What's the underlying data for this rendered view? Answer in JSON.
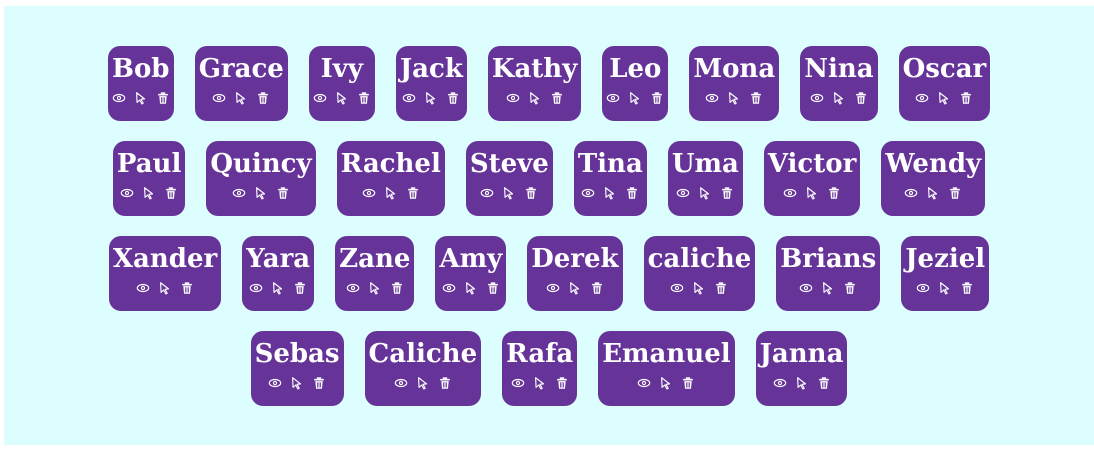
{
  "cards": [
    {
      "name": "Bob"
    },
    {
      "name": "Grace"
    },
    {
      "name": "Ivy"
    },
    {
      "name": "Jack"
    },
    {
      "name": "Kathy"
    },
    {
      "name": "Leo"
    },
    {
      "name": "Mona"
    },
    {
      "name": "Nina"
    },
    {
      "name": "Oscar"
    },
    {
      "name": "Paul"
    },
    {
      "name": "Quincy"
    },
    {
      "name": "Rachel"
    },
    {
      "name": "Steve"
    },
    {
      "name": "Tina"
    },
    {
      "name": "Uma"
    },
    {
      "name": "Victor"
    },
    {
      "name": "Wendy"
    },
    {
      "name": "Xander"
    },
    {
      "name": "Yara"
    },
    {
      "name": "Zane"
    },
    {
      "name": "Amy"
    },
    {
      "name": "Derek"
    },
    {
      "name": "caliche"
    },
    {
      "name": "Brians"
    },
    {
      "name": "Jeziel"
    },
    {
      "name": "Sebas"
    },
    {
      "name": "Caliche"
    },
    {
      "name": "Rafa"
    },
    {
      "name": "Emanuel"
    },
    {
      "name": "Janna"
    }
  ],
  "icons": {
    "view": "eye-icon",
    "select": "cursor-arrow-icon",
    "delete": "trash-icon"
  },
  "colors": {
    "background": "#dcfefe",
    "card": "#663399",
    "text": "#ffffff"
  }
}
